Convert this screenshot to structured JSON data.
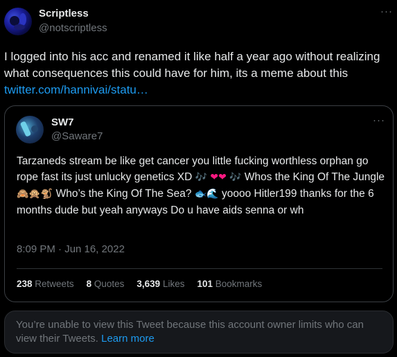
{
  "author": {
    "name": "Scriptless",
    "handle": "@notscriptless",
    "more": "···"
  },
  "tweet": {
    "text": "I logged into his acc and renamed it like half a year ago without realizing what consequences this could have for him, its a meme about this",
    "link": "twitter.com/hannivai/statu…"
  },
  "quote": {
    "name": "SW7",
    "handle": "@Saware7",
    "more": "···",
    "text_parts": {
      "p1": "Tarzaneds stream be like get cancer you little fucking worthless orphan go rope fast its just unlucky genetics XD ",
      "notes1": "🎶",
      "hearts": "❤❤",
      "notes2": "🎶",
      "p2": " Whos the King Of The Jungle ",
      "monkeys": "🙈🙊🐒",
      "p3": " Who’s the King Of The Sea? ",
      "sea": "🐟🌊",
      "p4": " yoooo Hitler199 thanks for the 6 months dude but yeah anyways Do u have aids senna or wh"
    },
    "date": "8:09 PM · Jun 16, 2022",
    "stats": [
      {
        "count": "238",
        "label": "Retweets"
      },
      {
        "count": "8",
        "label": "Quotes"
      },
      {
        "count": "3,639",
        "label": "Likes"
      },
      {
        "count": "101",
        "label": "Bookmarks"
      }
    ]
  },
  "notice": {
    "text": "You’re unable to view this Tweet because this account owner limits who can view their Tweets. ",
    "link": "Learn more"
  }
}
